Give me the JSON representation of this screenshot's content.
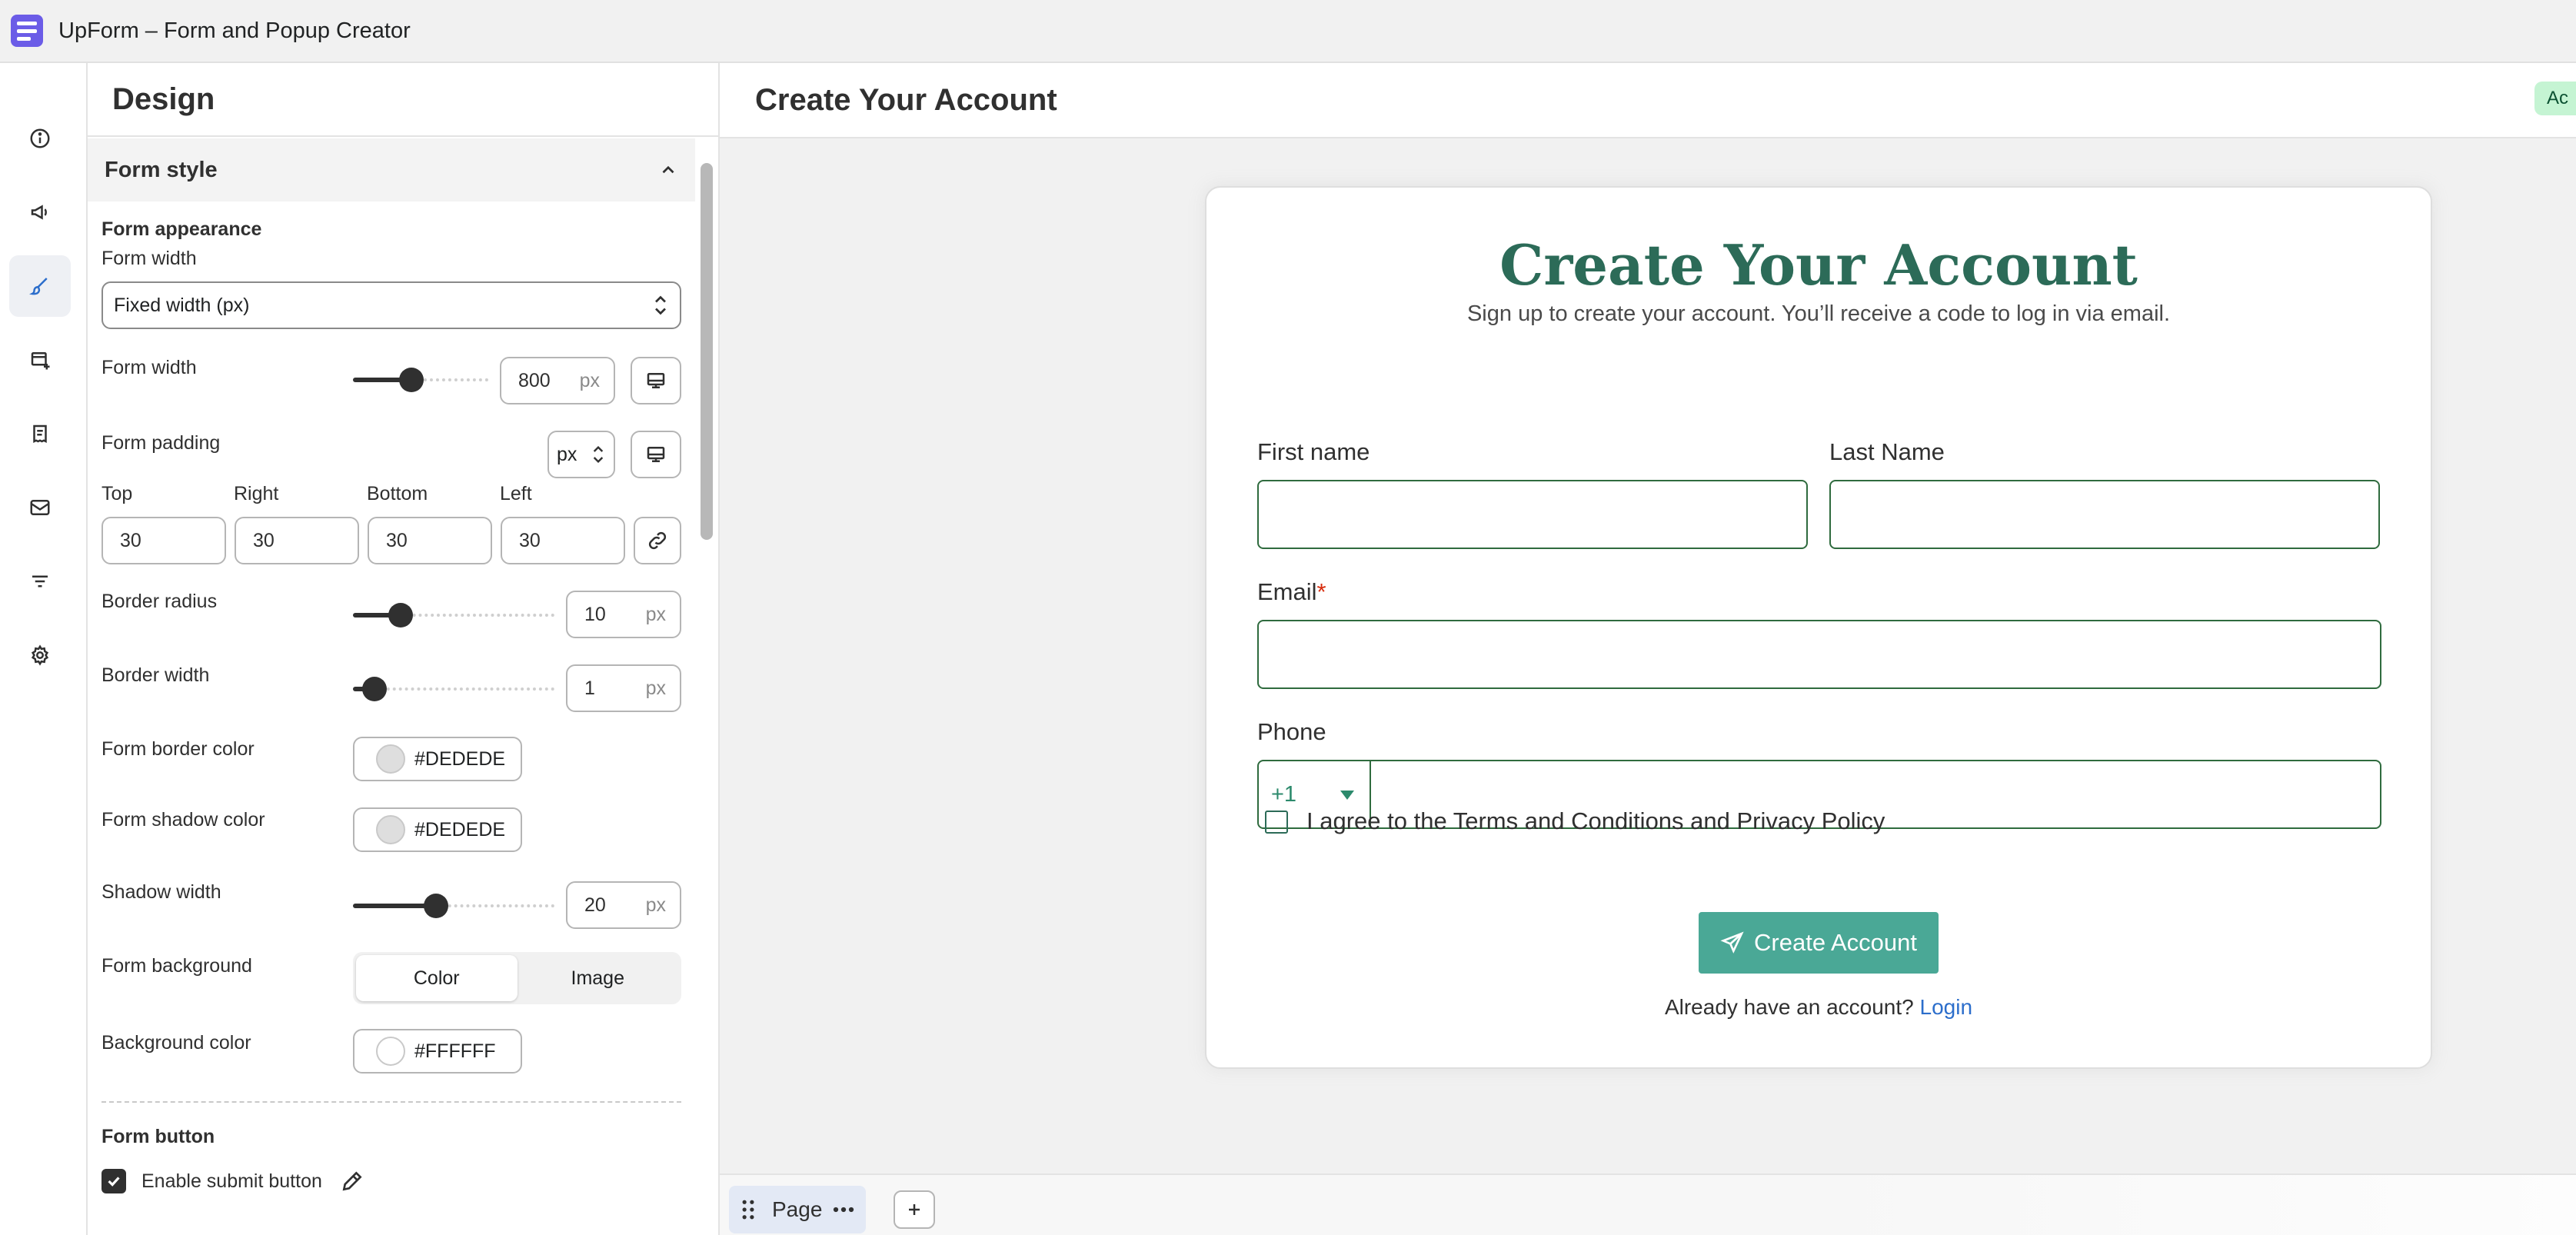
{
  "app": {
    "title": "UpForm – Form and Popup Creator"
  },
  "rail": {
    "items": [
      {
        "icon": "info-icon"
      },
      {
        "icon": "megaphone-icon"
      },
      {
        "icon": "brush-icon",
        "active": true
      },
      {
        "icon": "add-form-icon"
      },
      {
        "icon": "receipt-icon"
      },
      {
        "icon": "mail-icon"
      },
      {
        "icon": "filter-icon"
      },
      {
        "icon": "gear-icon"
      }
    ]
  },
  "design": {
    "title": "Design",
    "section_title": "Form style",
    "appearance_heading": "Form appearance",
    "form_width_mode_label": "Form width",
    "form_width_mode_value": "Fixed width (px)",
    "form_width_label": "Form width",
    "form_width_value": "800",
    "form_width_slider": 0.42,
    "unit_px": "px",
    "padding_label": "Form padding",
    "padding_unit": "px",
    "padding": {
      "top_label": "Top",
      "top": "30",
      "right_label": "Right",
      "right": "30",
      "bottom_label": "Bottom",
      "bottom": "30",
      "left_label": "Left",
      "left": "30"
    },
    "border_radius_label": "Border radius",
    "border_radius_value": "10",
    "border_radius_slider": 0.2,
    "border_width_label": "Border width",
    "border_width_value": "1",
    "border_width_slider": 0.05,
    "border_color_label": "Form border color",
    "border_color_value": "#DEDEDE",
    "shadow_color_label": "Form shadow color",
    "shadow_color_value": "#DEDEDE",
    "shadow_width_label": "Shadow width",
    "shadow_width_value": "20",
    "shadow_width_slider": 0.4,
    "background_label": "Form background",
    "background_options": [
      "Color",
      "Image"
    ],
    "background_selected": "Color",
    "background_color_label": "Background color",
    "background_color_value": "#FFFFFF",
    "button_heading": "Form button",
    "enable_submit_label": "Enable submit button",
    "enable_submit_checked": true
  },
  "preview": {
    "header_title": "Create Your Account",
    "status_pill": "Ac",
    "form": {
      "title": "Create Your Account",
      "subtitle": "Sign up to create your account. You’ll receive a code to log in via email.",
      "first_name_label": "First name",
      "last_name_label": "Last Name",
      "email_label": "Email",
      "required_mark": "*",
      "phone_label": "Phone",
      "phone_code": "+1",
      "agree_label": "I agree to the Terms and Conditions and Privacy Policy",
      "submit_label": "Create Account",
      "already_text": "Already have an account?",
      "login_link": "Login"
    }
  },
  "pages": {
    "tab_label": "Page"
  },
  "colors": {
    "accent": "#4AA896",
    "title_green": "#2C6B58",
    "input_border": "#2F6B3E",
    "app_logo": "#6B5CE7"
  }
}
